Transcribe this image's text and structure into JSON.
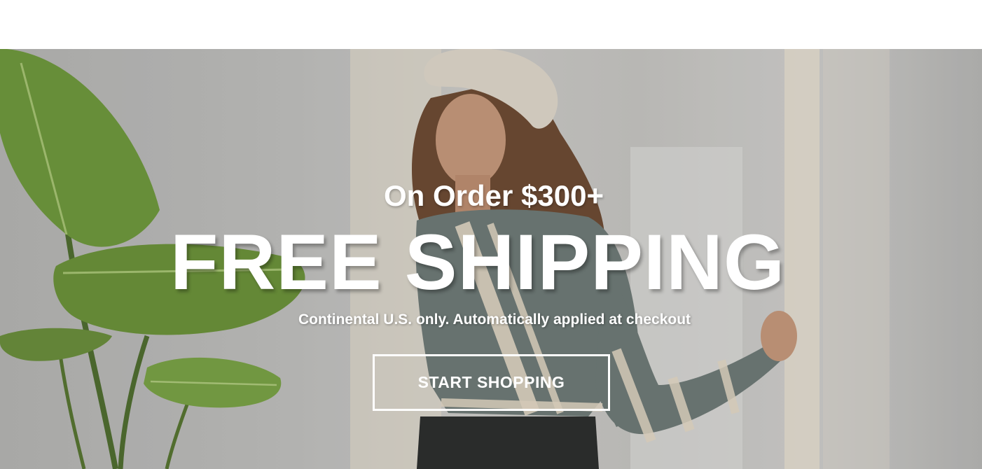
{
  "hero": {
    "subhead": "On Order $300+",
    "headline": "FREE SHIPPING",
    "fine_print": "Continental U.S. only. Automatically applied at checkout",
    "cta_label": "START SHOPPING"
  },
  "colors": {
    "text": "#ffffff",
    "leaf_green": "#6f9a3c",
    "sweater_gray": "#6f7b78",
    "sweater_stripe": "#e7dcc8",
    "beret": "#e3dbcd",
    "hair": "#6e4a31",
    "curtain": "#e7dfcf"
  }
}
